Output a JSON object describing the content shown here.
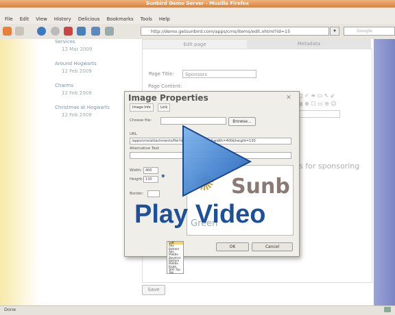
{
  "window": {
    "title": "Sunbird Demo Server - Mozilla Firefox"
  },
  "menu": [
    "File",
    "Edit",
    "View",
    "History",
    "Delicious",
    "Bookmarks",
    "Tools",
    "Help"
  ],
  "toolbar": {
    "url": "http://demo.getsunbird.com/apps/cms/items/edit.xhtml?id=15",
    "search_placeholder": "Google"
  },
  "sidebar": {
    "items": [
      {
        "title": "Services",
        "date": "12 Mar 2009"
      },
      {
        "title": "Around Hogwarts",
        "date": "12 Feb 2009"
      },
      {
        "title": "Charms",
        "date": "12 Feb 2009"
      },
      {
        "title": "Christmas at Hogwarts",
        "date": "12 Feb 2009"
      }
    ]
  },
  "editor": {
    "tabs": [
      "Edit page",
      "Metadata"
    ],
    "page_title_label": "Page Title:",
    "page_title_value": "Sponsors",
    "page_content_label": "Page Content:",
    "body_text": "s for sponsoring",
    "cancel_label": "Save"
  },
  "dialog": {
    "title": "Image Properties",
    "tabs": [
      "Image Info",
      "Link"
    ],
    "choose_file_label": "Choose file:",
    "browse_label": "Browse...",
    "url_label": "URL",
    "url_value": "/apps/cms/attachments/file?disposition=inline&width=400&height=130",
    "alt_label": "Alternative Text",
    "width_label": "Width:",
    "width_value": "400",
    "height_label": "Height:",
    "height_value": "130",
    "border_label": "Border:",
    "ok_label": "OK",
    "cancel_label": "Cancel",
    "preview_logo": "Sunb",
    "preview_caption": "Green",
    "align_options": [
      "Left",
      "Abs Bottom",
      "Abs Middle",
      "Baseline",
      "Bottom",
      "Middle",
      "Right",
      "Text Top",
      "Top"
    ]
  },
  "overlay": {
    "play_label": "Play Video"
  },
  "status": {
    "text": "Done"
  },
  "colors": {
    "play_blue": "#1e4f9a",
    "title_orange": "#e0924e"
  }
}
